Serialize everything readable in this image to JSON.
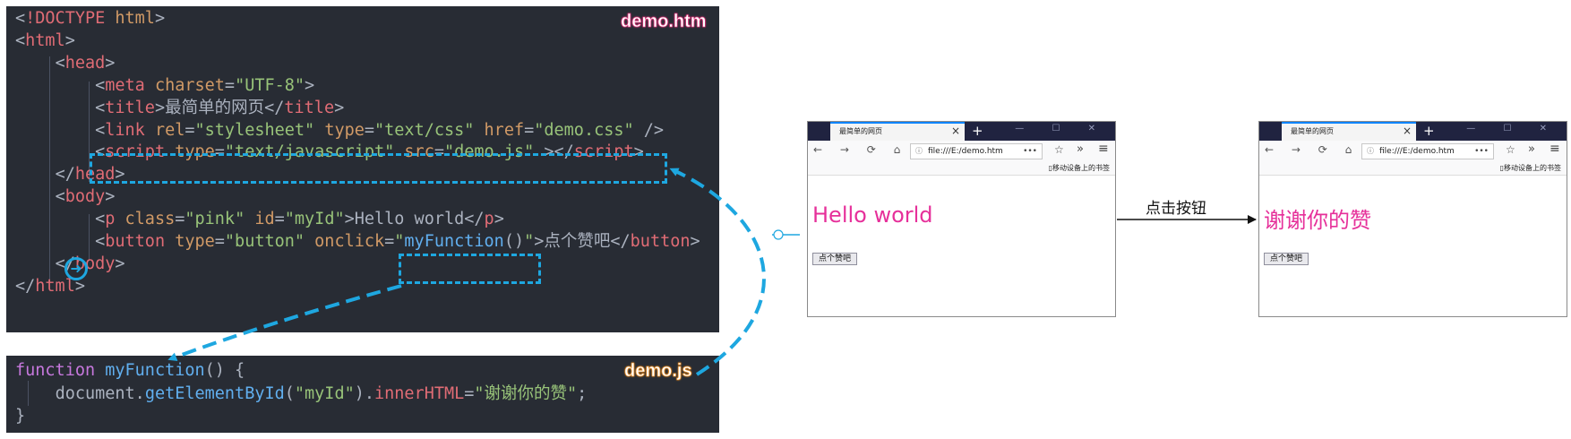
{
  "html_file": {
    "label": "demo.htm",
    "lines": [
      [
        [
          "pun",
          "<"
        ],
        [
          "tag",
          "!DOCTYPE"
        ],
        [
          "txt",
          " "
        ],
        [
          "attr",
          "html"
        ],
        [
          "pun",
          ">"
        ]
      ],
      [
        [
          "pun",
          "<"
        ],
        [
          "tag",
          "html"
        ],
        [
          "pun",
          ">"
        ]
      ],
      [
        [
          "txt",
          "    "
        ],
        [
          "pun",
          "<"
        ],
        [
          "tag",
          "head"
        ],
        [
          "pun",
          ">"
        ]
      ],
      [
        [
          "txt",
          "        "
        ],
        [
          "pun",
          "<"
        ],
        [
          "tag",
          "meta"
        ],
        [
          "txt",
          " "
        ],
        [
          "attr",
          "charset"
        ],
        [
          "pun",
          "="
        ],
        [
          "str",
          "\"UTF-8\""
        ],
        [
          "pun",
          ">"
        ]
      ],
      [
        [
          "txt",
          "        "
        ],
        [
          "pun",
          "<"
        ],
        [
          "tag",
          "title"
        ],
        [
          "pun",
          ">"
        ],
        [
          "txt",
          "最简单的网页"
        ],
        [
          "pun",
          "</"
        ],
        [
          "tag",
          "title"
        ],
        [
          "pun",
          ">"
        ]
      ],
      [
        [
          "txt",
          "        "
        ],
        [
          "pun",
          "<"
        ],
        [
          "tag",
          "link"
        ],
        [
          "txt",
          " "
        ],
        [
          "attr",
          "rel"
        ],
        [
          "pun",
          "="
        ],
        [
          "str",
          "\"stylesheet\""
        ],
        [
          "txt",
          " "
        ],
        [
          "attr",
          "type"
        ],
        [
          "pun",
          "="
        ],
        [
          "str",
          "\"text/css\""
        ],
        [
          "txt",
          " "
        ],
        [
          "attr",
          "href"
        ],
        [
          "pun",
          "="
        ],
        [
          "str",
          "\"demo.css\""
        ],
        [
          "txt",
          " "
        ],
        [
          "pun",
          "/>"
        ]
      ],
      [
        [
          "txt",
          "        "
        ],
        [
          "pun",
          "<"
        ],
        [
          "tag",
          "script"
        ],
        [
          "txt",
          " "
        ],
        [
          "attr",
          "type"
        ],
        [
          "pun",
          "="
        ],
        [
          "str",
          "\"text/javascript\""
        ],
        [
          "txt",
          " "
        ],
        [
          "attr",
          "src"
        ],
        [
          "pun",
          "="
        ],
        [
          "str",
          "\"demo.js\""
        ],
        [
          "txt",
          " "
        ],
        [
          "pun",
          "></"
        ],
        [
          "tag",
          "script"
        ],
        [
          "pun",
          ">"
        ]
      ],
      [
        [
          "txt",
          "    "
        ],
        [
          "pun",
          "</"
        ],
        [
          "tag",
          "head"
        ],
        [
          "pun",
          ">"
        ]
      ],
      [
        [
          "txt",
          "    "
        ],
        [
          "pun",
          "<"
        ],
        [
          "tag",
          "body"
        ],
        [
          "pun",
          ">"
        ]
      ],
      [
        [
          "txt",
          "        "
        ],
        [
          "pun",
          "<"
        ],
        [
          "tag",
          "p"
        ],
        [
          "txt",
          " "
        ],
        [
          "attr",
          "class"
        ],
        [
          "pun",
          "="
        ],
        [
          "str",
          "\"pink\""
        ],
        [
          "txt",
          " "
        ],
        [
          "attr",
          "id"
        ],
        [
          "pun",
          "="
        ],
        [
          "str",
          "\"myId\""
        ],
        [
          "pun",
          ">"
        ],
        [
          "txt",
          "Hello world"
        ],
        [
          "pun",
          "</"
        ],
        [
          "tag",
          "p"
        ],
        [
          "pun",
          ">"
        ]
      ],
      [
        [
          "txt",
          "        "
        ],
        [
          "pun",
          "<"
        ],
        [
          "tag",
          "button"
        ],
        [
          "txt",
          " "
        ],
        [
          "attr",
          "type"
        ],
        [
          "pun",
          "="
        ],
        [
          "str",
          "\"button\""
        ],
        [
          "txt",
          " "
        ],
        [
          "attr",
          "onclick"
        ],
        [
          "pun",
          "="
        ],
        [
          "str",
          "\""
        ],
        [
          "fn",
          "myFunction"
        ],
        [
          "pun",
          "()"
        ],
        [
          "str",
          "\""
        ],
        [
          "pun",
          ">"
        ],
        [
          "txt",
          "点个赞吧"
        ],
        [
          "pun",
          "</"
        ],
        [
          "tag",
          "button"
        ],
        [
          "pun",
          ">"
        ]
      ],
      [
        [
          "txt",
          "    "
        ],
        [
          "pun",
          "</"
        ],
        [
          "tag",
          "body"
        ],
        [
          "pun",
          ">"
        ]
      ],
      [
        [
          "pun",
          "</"
        ],
        [
          "tag",
          "html"
        ],
        [
          "pun",
          ">"
        ]
      ]
    ]
  },
  "js_file": {
    "label": "demo.js",
    "lines": [
      [
        [
          "kw",
          "function"
        ],
        [
          "txt",
          " "
        ],
        [
          "fn",
          "myFunction"
        ],
        [
          "pun",
          "() {"
        ]
      ],
      [
        [
          "txt",
          "    "
        ],
        [
          "txt",
          "document"
        ],
        [
          "pun",
          "."
        ],
        [
          "fn",
          "getElementById"
        ],
        [
          "pun",
          "("
        ],
        [
          "str",
          "\"myId\""
        ],
        [
          "pun",
          ")."
        ],
        [
          "prop",
          "innerHTML"
        ],
        [
          "pun",
          "="
        ],
        [
          "str",
          "\"谢谢你的赞\""
        ],
        [
          "pun",
          ";"
        ]
      ],
      [
        [
          "pun",
          "}"
        ]
      ]
    ]
  },
  "browser": {
    "tab_title": "最简单的网页",
    "tab_close": "×",
    "new_tab": "+",
    "window_buttons": "— ☐ ✕",
    "nav_icons": "← → ⟳ ⌂",
    "url_info": "ⓘ",
    "url": "file:///E:/demo.htm",
    "url_more": "•••",
    "star": "☆",
    "overflow": "»",
    "menu": "≡",
    "bookmarks_label": "▯移动设备上的书签",
    "button_label": "点个赞吧"
  },
  "before": {
    "paragraph_text": "Hello world"
  },
  "after": {
    "paragraph_text": "谢谢你的赞"
  },
  "arrow_label": "点击按钮",
  "colors": {
    "code_bg": "#282c34",
    "highlight": "#1ea7e0",
    "pink_text": "#e6309a"
  }
}
